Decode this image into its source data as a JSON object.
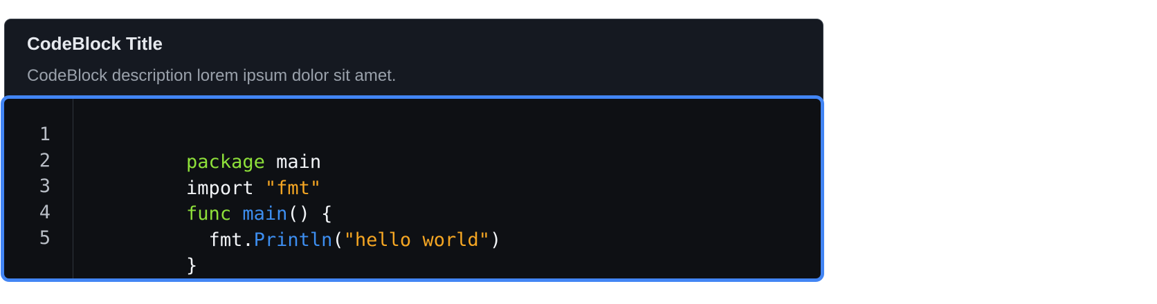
{
  "codeblock": {
    "title": "CodeBlock Title",
    "description": "CodeBlock description lorem ipsum dolor sit amet.",
    "lines": [
      {
        "number": "1",
        "tokens": [
          {
            "t": "package",
            "k": "keyword"
          },
          {
            "t": " main",
            "k": "plain"
          }
        ]
      },
      {
        "number": "2",
        "tokens": [
          {
            "t": "import ",
            "k": "plain"
          },
          {
            "t": "\"fmt\"",
            "k": "string"
          }
        ]
      },
      {
        "number": "3",
        "tokens": [
          {
            "t": "func",
            "k": "keyword"
          },
          {
            "t": " ",
            "k": "plain"
          },
          {
            "t": "main",
            "k": "fn"
          },
          {
            "t": "() {",
            "k": "plain"
          }
        ]
      },
      {
        "number": "4",
        "tokens": [
          {
            "t": "  fmt.",
            "k": "plain"
          },
          {
            "t": "Println",
            "k": "fn"
          },
          {
            "t": "(",
            "k": "plain"
          },
          {
            "t": "\"hello world\"",
            "k": "string"
          },
          {
            "t": ")",
            "k": "plain"
          }
        ]
      },
      {
        "number": "5",
        "tokens": [
          {
            "t": "}",
            "k": "plain"
          }
        ]
      }
    ]
  },
  "colors": {
    "keyword": "#8ee03a",
    "string": "#f5a623",
    "function": "#3d8ef0",
    "focus_ring": "#4285f4"
  }
}
